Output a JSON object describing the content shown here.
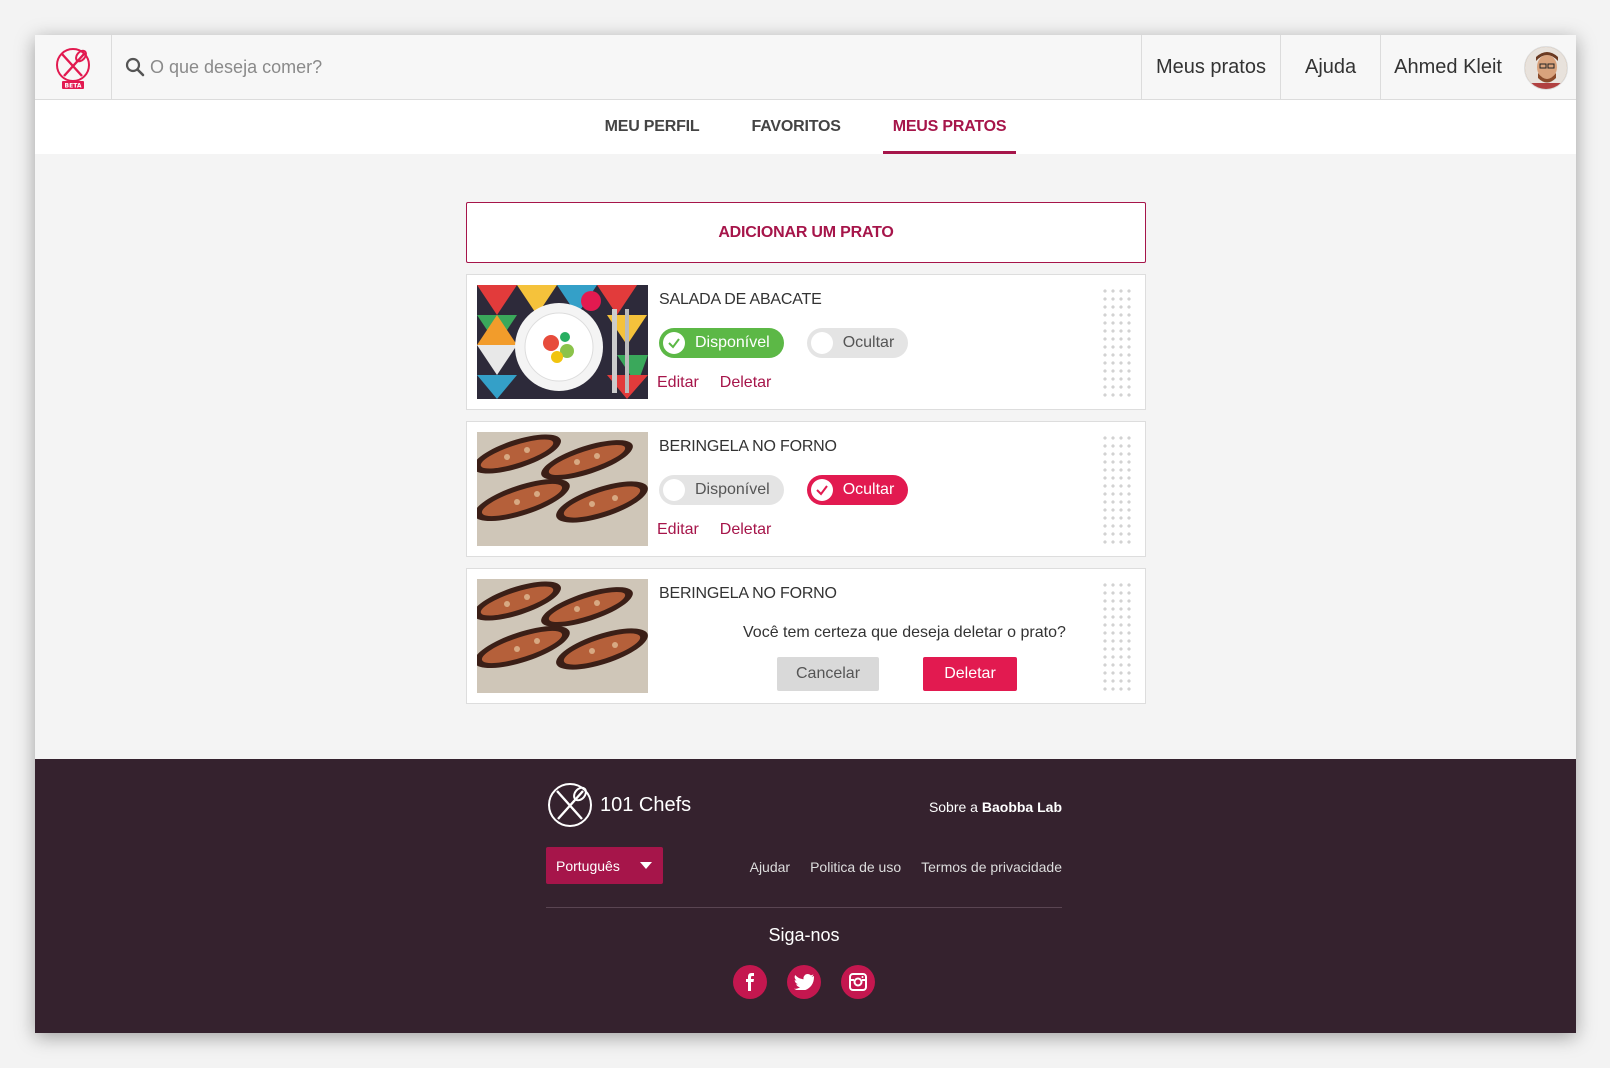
{
  "header": {
    "search_placeholder": "O que deseja comer?",
    "nav": {
      "my_dishes": "Meus pratos",
      "help": "Ajuda",
      "user_name": "Ahmed Kleit"
    },
    "logo_badge": "BETA"
  },
  "tabs": [
    {
      "label": "MEU PERFIL",
      "active": false
    },
    {
      "label": "FAVORITOS",
      "active": false
    },
    {
      "label": "MEUS PRATOS",
      "active": true
    }
  ],
  "main": {
    "add_button": "ADICIONAR UM PRATO",
    "dishes": [
      {
        "title": "SALADA DE ABACATE",
        "available_label": "Disponível",
        "hide_label": "Ocultar",
        "state": "available",
        "edit": "Editar",
        "delete": "Deletar"
      },
      {
        "title": "BERINGELA NO FORNO",
        "available_label": "Disponível",
        "hide_label": "Ocultar",
        "state": "hidden",
        "edit": "Editar",
        "delete": "Deletar"
      },
      {
        "title": "BERINGELA NO FORNO",
        "confirm_question": "Você tem certeza que deseja deletar o prato?",
        "cancel": "Cancelar",
        "delete": "Deletar"
      }
    ]
  },
  "footer": {
    "brand": "101 Chefs",
    "about_prefix": "Sobre a",
    "about_company": "Baobba Lab",
    "language": "Português",
    "links": [
      "Ajudar",
      "Politica de uso",
      "Termos de privacidade"
    ],
    "follow": "Siga-nos",
    "social": [
      "facebook-icon",
      "twitter-icon",
      "instagram-icon"
    ]
  },
  "colors": {
    "accent": "#a6154a",
    "danger": "#e21a50",
    "success": "#5cb846",
    "footer_bg": "#35222e"
  }
}
